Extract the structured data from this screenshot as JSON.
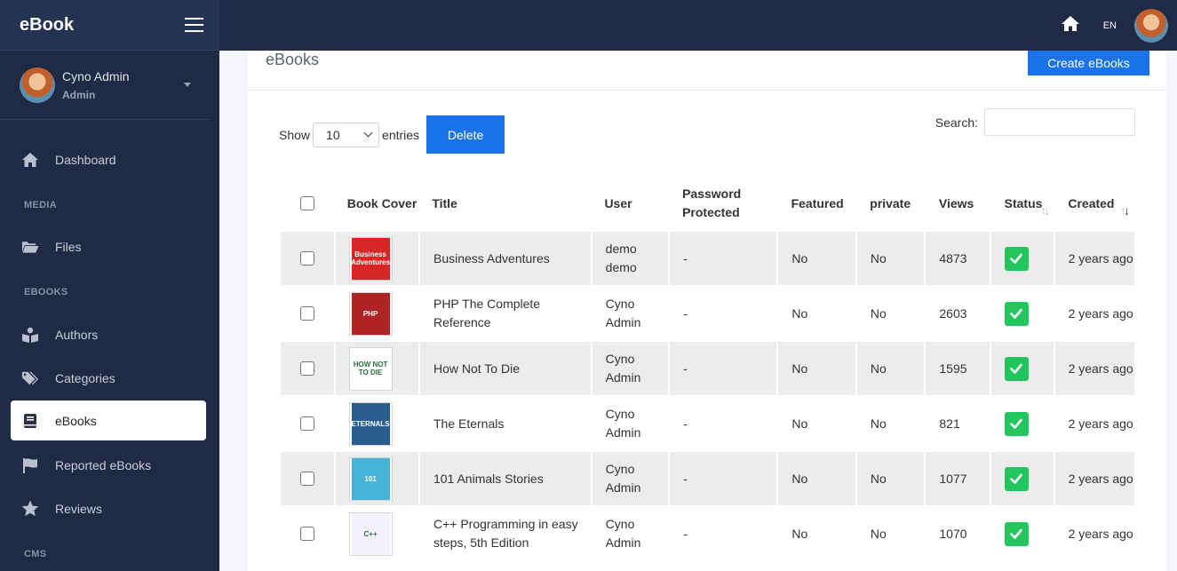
{
  "app": {
    "brand": "eBook"
  },
  "user": {
    "name": "Cyno Admin",
    "role": "Admin"
  },
  "nav": {
    "dashboard": "Dashboard",
    "media_header": "MEDIA",
    "files": "Files",
    "ebooks_header": "EBOOKS",
    "authors": "Authors",
    "categories": "Categories",
    "ebooks": "eBooks",
    "reported": "Reported eBooks",
    "reviews": "Reviews",
    "cms_header": "CMS"
  },
  "topbar": {
    "lang": "EN"
  },
  "card": {
    "title": "eBooks",
    "create_label": "Create eBooks"
  },
  "controls": {
    "show_label": "Show",
    "entries_value": "10",
    "entries_label": "entries",
    "delete_label": "Delete",
    "search_label": "Search:",
    "search_value": ""
  },
  "table": {
    "headers": {
      "cover": "Book Cover",
      "title": "Title",
      "user": "User",
      "password": "Password Protected",
      "featured": "Featured",
      "private": "private",
      "views": "Views",
      "status": "Status",
      "created": "Created"
    },
    "rows": [
      {
        "title": "Business Adventures",
        "user": "demo demo",
        "password": "-",
        "featured": "No",
        "private": "No",
        "views": "4873",
        "created": "2 years ago",
        "cover_color": "#d62626",
        "cover_text": "Business Adventures"
      },
      {
        "title": "PHP The Complete Reference",
        "user": "Cyno Admin",
        "password": "-",
        "featured": "No",
        "private": "No",
        "views": "2603",
        "created": "2 years ago",
        "cover_color": "#b02323",
        "cover_text": "PHP"
      },
      {
        "title": "How Not To Die",
        "user": "Cyno Admin",
        "password": "-",
        "featured": "No",
        "private": "No",
        "views": "1595",
        "created": "2 years ago",
        "cover_color": "#ffffff",
        "cover_text": "HOW NOT TO DIE"
      },
      {
        "title": "The Eternals",
        "user": "Cyno Admin",
        "password": "-",
        "featured": "No",
        "private": "No",
        "views": "821",
        "created": "2 years ago",
        "cover_color": "#2a5d8f",
        "cover_text": "ETERNALS"
      },
      {
        "title": "101 Animals Stories",
        "user": "Cyno Admin",
        "password": "-",
        "featured": "No",
        "private": "No",
        "views": "1077",
        "created": "2 years ago",
        "cover_color": "#48b3d9",
        "cover_text": "101"
      },
      {
        "title": "C++ Programming in easy steps, 5th Edition",
        "user": "Cyno Admin",
        "password": "-",
        "featured": "No",
        "private": "No",
        "views": "1070",
        "created": "2 years ago",
        "cover_color": "#f3f0ff",
        "cover_text": "C++"
      }
    ]
  },
  "colors": {
    "sidebar": "#1f2a44",
    "primary": "#1a73e8",
    "status_green": "#22c55e"
  }
}
